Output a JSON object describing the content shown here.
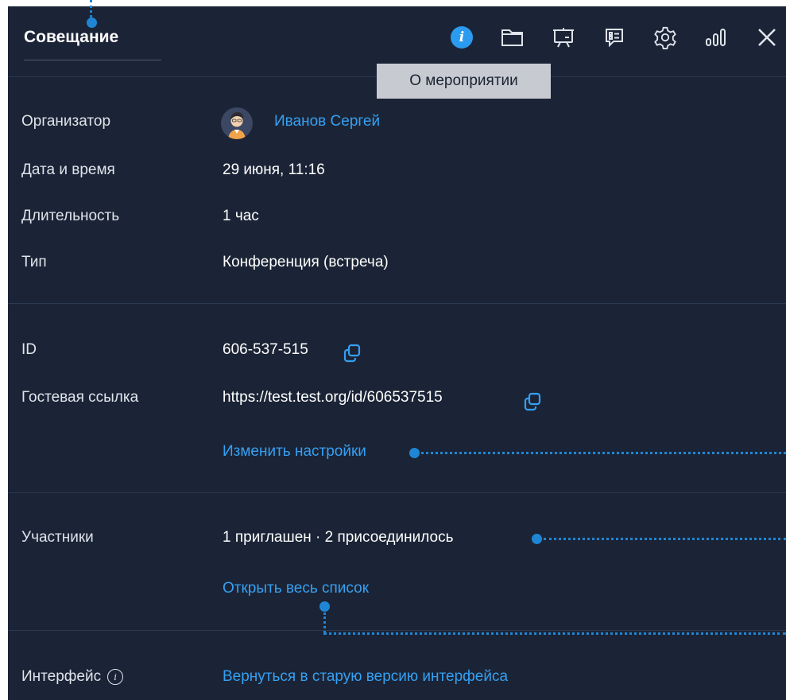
{
  "header": {
    "title": "Совещание",
    "tooltip": "О мероприятии",
    "icons": [
      "info-icon",
      "folder-icon",
      "presentation-icon",
      "chat-icon",
      "settings-icon",
      "stats-icon",
      "close-icon"
    ],
    "info_glyph": "i"
  },
  "info": {
    "organizer_label": "Организатор",
    "organizer_name": "Иванов Сергей",
    "datetime_label": "Дата и время",
    "datetime_value": "29 июня, 11:16",
    "duration_label": "Длительность",
    "duration_value": "1 час",
    "type_label": "Тип",
    "type_value": "Конференция (встреча)"
  },
  "access": {
    "id_label": "ID",
    "id_value": "606-537-515",
    "guest_label": "Гостевая ссылка",
    "guest_value": "https://test.test.org/id/606537515",
    "settings_link": "Изменить настройки"
  },
  "participants": {
    "label": "Участники",
    "value": "1 приглашен · 2 присоединилось",
    "open_list_link": "Открыть весь список"
  },
  "interface": {
    "label": "Интерфейс",
    "info_glyph": "i",
    "old_version_link": "Вернуться в старую версию интерфейса"
  },
  "colors": {
    "background": "#1b2436",
    "accent": "#35a0f2",
    "annotation": "#1e86d4",
    "tooltip_bg": "#c7cbd1"
  }
}
